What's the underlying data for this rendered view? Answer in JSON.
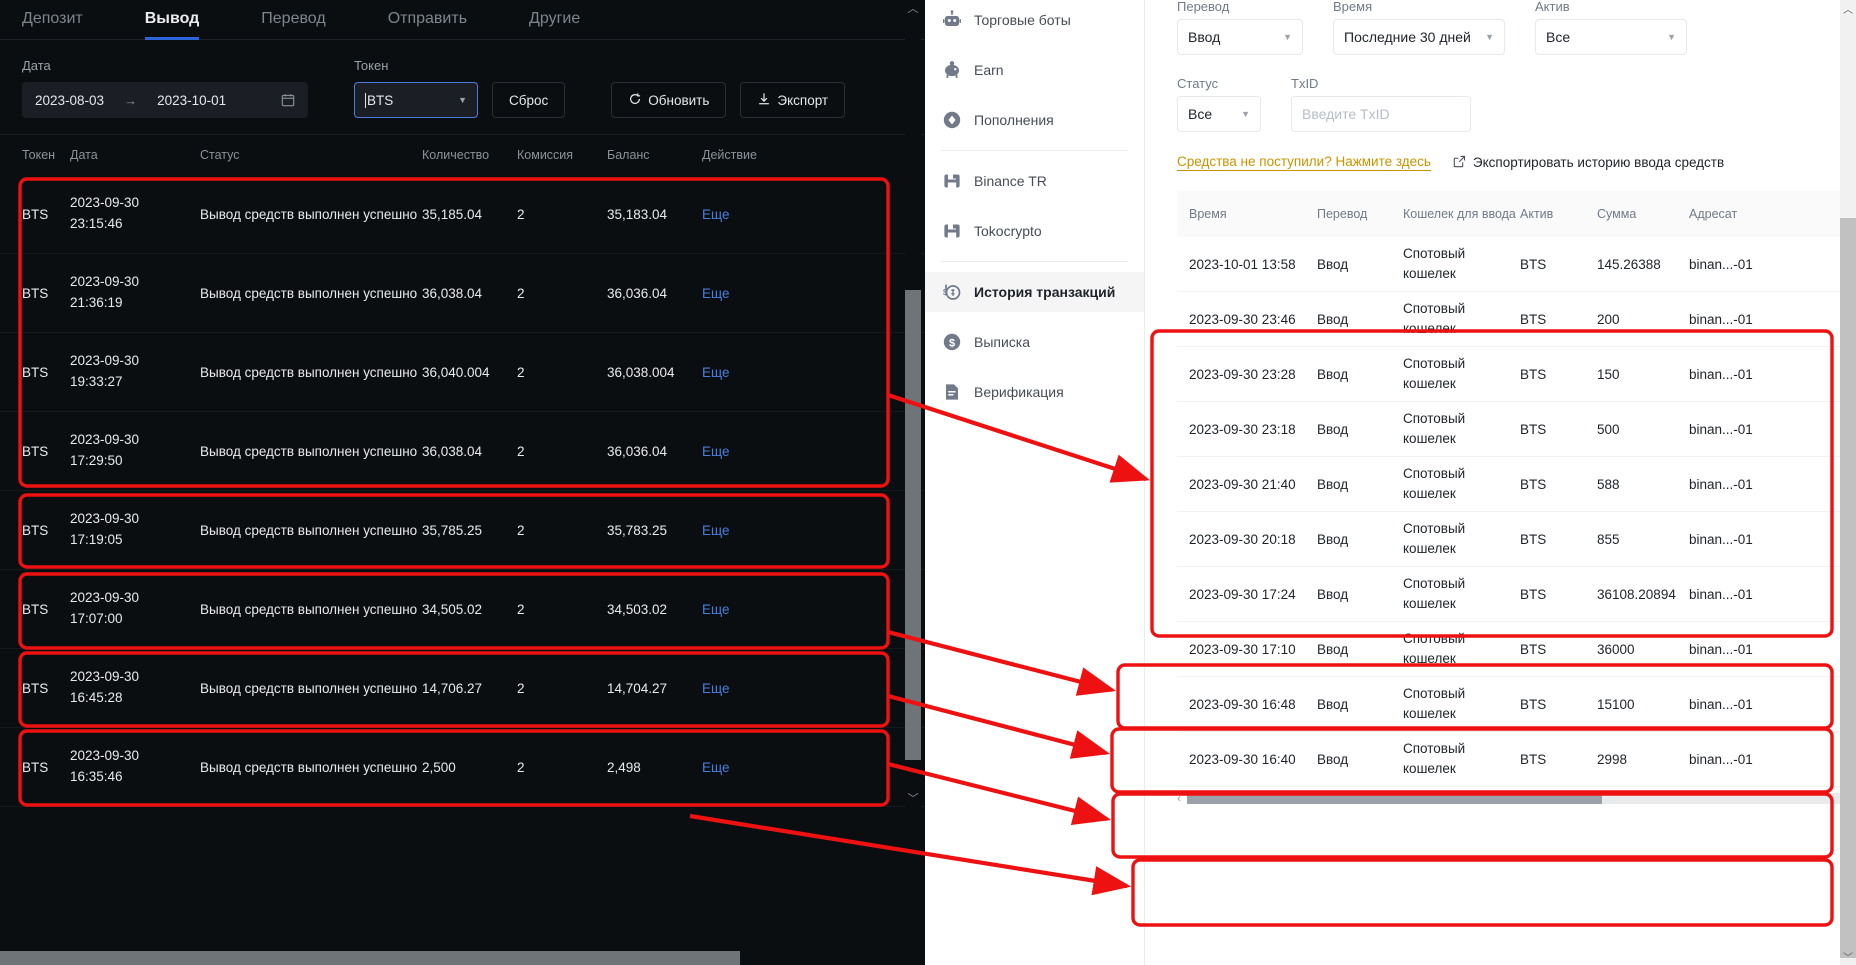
{
  "left_panel": {
    "tabs": [
      {
        "label": "Депозит",
        "active": false
      },
      {
        "label": "Вывод",
        "active": true
      },
      {
        "label": "Перевод",
        "active": false
      },
      {
        "label": "Отправить",
        "active": false
      },
      {
        "label": "Другие",
        "active": false
      }
    ],
    "filters": {
      "date_label": "Дата",
      "date_from": "2023-08-03",
      "date_arrow": "→",
      "date_to": "2023-10-01",
      "token_label": "Токен",
      "token_value": "BTS",
      "reset_button": "Сброс",
      "refresh_button": "Обновить",
      "export_button": "Экспорт"
    },
    "table": {
      "headers": [
        "Токен",
        "Дата",
        "Статус",
        "Количество",
        "Комиссия",
        "Баланс",
        "Действие"
      ],
      "action_label": "Еще",
      "rows": [
        {
          "token": "BTS",
          "date": "2023-09-30",
          "time": "23:15:46",
          "status": "Вывод средств выполнен успешно",
          "quantity": "35,185.04",
          "fee": "2",
          "balance": "35,183.04"
        },
        {
          "token": "BTS",
          "date": "2023-09-30",
          "time": "21:36:19",
          "status": "Вывод средств выполнен успешно",
          "quantity": "36,038.04",
          "fee": "2",
          "balance": "36,036.04"
        },
        {
          "token": "BTS",
          "date": "2023-09-30",
          "time": "19:33:27",
          "status": "Вывод средств выполнен успешно",
          "quantity": "36,040.004",
          "fee": "2",
          "balance": "36,038.004"
        },
        {
          "token": "BTS",
          "date": "2023-09-30",
          "time": "17:29:50",
          "status": "Вывод средств выполнен успешно",
          "quantity": "36,038.04",
          "fee": "2",
          "balance": "36,036.04"
        },
        {
          "token": "BTS",
          "date": "2023-09-30",
          "time": "17:19:05",
          "status": "Вывод средств выполнен успешно",
          "quantity": "35,785.25",
          "fee": "2",
          "balance": "35,783.25"
        },
        {
          "token": "BTS",
          "date": "2023-09-30",
          "time": "17:07:00",
          "status": "Вывод средств выполнен успешно",
          "quantity": "34,505.02",
          "fee": "2",
          "balance": "34,503.02"
        },
        {
          "token": "BTS",
          "date": "2023-09-30",
          "time": "16:45:28",
          "status": "Вывод средств выполнен успешно",
          "quantity": "14,706.27",
          "fee": "2",
          "balance": "14,704.27"
        },
        {
          "token": "BTS",
          "date": "2023-09-30",
          "time": "16:35:46",
          "status": "Вывод средств выполнен успешно",
          "quantity": "2,500",
          "fee": "2",
          "balance": "2,498"
        }
      ]
    }
  },
  "sidebar": {
    "items": [
      {
        "label": "Торговые боты",
        "icon": "robot-icon",
        "active": false,
        "sep_after": false
      },
      {
        "label": "Earn",
        "icon": "piggy-bank-icon",
        "active": false,
        "sep_after": false
      },
      {
        "label": "Пополнения",
        "icon": "diamond-icon",
        "active": false,
        "sep_after": true
      },
      {
        "label": "Binance TR",
        "icon": "card-icon",
        "active": false,
        "sep_after": false
      },
      {
        "label": "Tokocrypto",
        "icon": "card-icon",
        "active": false,
        "sep_after": true
      },
      {
        "label": "История транзакций",
        "icon": "history-money-icon",
        "active": true,
        "sep_after": false
      },
      {
        "label": "Выписка",
        "icon": "dollar-circle-icon",
        "active": false,
        "sep_after": false
      },
      {
        "label": "Верификация",
        "icon": "document-check-icon",
        "active": false,
        "sep_after": false
      }
    ]
  },
  "right_panel": {
    "filters": {
      "transfer_label": "Перевод",
      "transfer_value": "Ввод",
      "time_label": "Время",
      "time_value": "Последние 30 дней",
      "asset_label": "Актив",
      "asset_value": "Все",
      "status_label": "Статус",
      "status_value": "Все",
      "txid_label": "TxID",
      "txid_placeholder": "Введите TxID"
    },
    "links": {
      "not_received": "Средства не поступили? Нажмите здесь",
      "export_history": "Экспортировать историю ввода средств"
    },
    "table": {
      "headers": [
        "Время",
        "Перевод",
        "Кошелек для ввода",
        "Актив",
        "Сумма",
        "Адресат"
      ],
      "rows": [
        {
          "time": "2023-10-01 13:58",
          "type": "Ввод",
          "wallet": "Спотовый кошелек",
          "asset": "BTS",
          "amount": "145.26388",
          "addr": "binan...-01"
        },
        {
          "time": "2023-09-30 23:46",
          "type": "Ввод",
          "wallet": "Спотовый кошелек",
          "asset": "BTS",
          "amount": "200",
          "addr": "binan...-01"
        },
        {
          "time": "2023-09-30 23:28",
          "type": "Ввод",
          "wallet": "Спотовый кошелек",
          "asset": "BTS",
          "amount": "150",
          "addr": "binan...-01"
        },
        {
          "time": "2023-09-30 23:18",
          "type": "Ввод",
          "wallet": "Спотовый кошелек",
          "asset": "BTS",
          "amount": "500",
          "addr": "binan...-01"
        },
        {
          "time": "2023-09-30 21:40",
          "type": "Ввод",
          "wallet": "Спотовый кошелек",
          "asset": "BTS",
          "amount": "588",
          "addr": "binan...-01"
        },
        {
          "time": "2023-09-30 20:18",
          "type": "Ввод",
          "wallet": "Спотовый кошелек",
          "asset": "BTS",
          "amount": "855",
          "addr": "binan...-01"
        },
        {
          "time": "2023-09-30 17:24",
          "type": "Ввод",
          "wallet": "Спотовый кошелек",
          "asset": "BTS",
          "amount": "36108.20894",
          "addr": "binan...-01"
        },
        {
          "time": "2023-09-30 17:10",
          "type": "Ввод",
          "wallet": "Спотовый кошелек",
          "asset": "BTS",
          "amount": "36000",
          "addr": "binan...-01"
        },
        {
          "time": "2023-09-30 16:48",
          "type": "Ввод",
          "wallet": "Спотовый кошелек",
          "asset": "BTS",
          "amount": "15100",
          "addr": "binan...-01"
        },
        {
          "time": "2023-09-30 16:40",
          "type": "Ввод",
          "wallet": "Спотовый кошелек",
          "asset": "BTS",
          "amount": "2998",
          "addr": "binan...-01"
        }
      ]
    }
  },
  "annotations": {
    "color": "#ee1111",
    "note": "Red highlight boxes pairing withdrawal rows on the left with deposit rows on the right, joined by arrows."
  }
}
